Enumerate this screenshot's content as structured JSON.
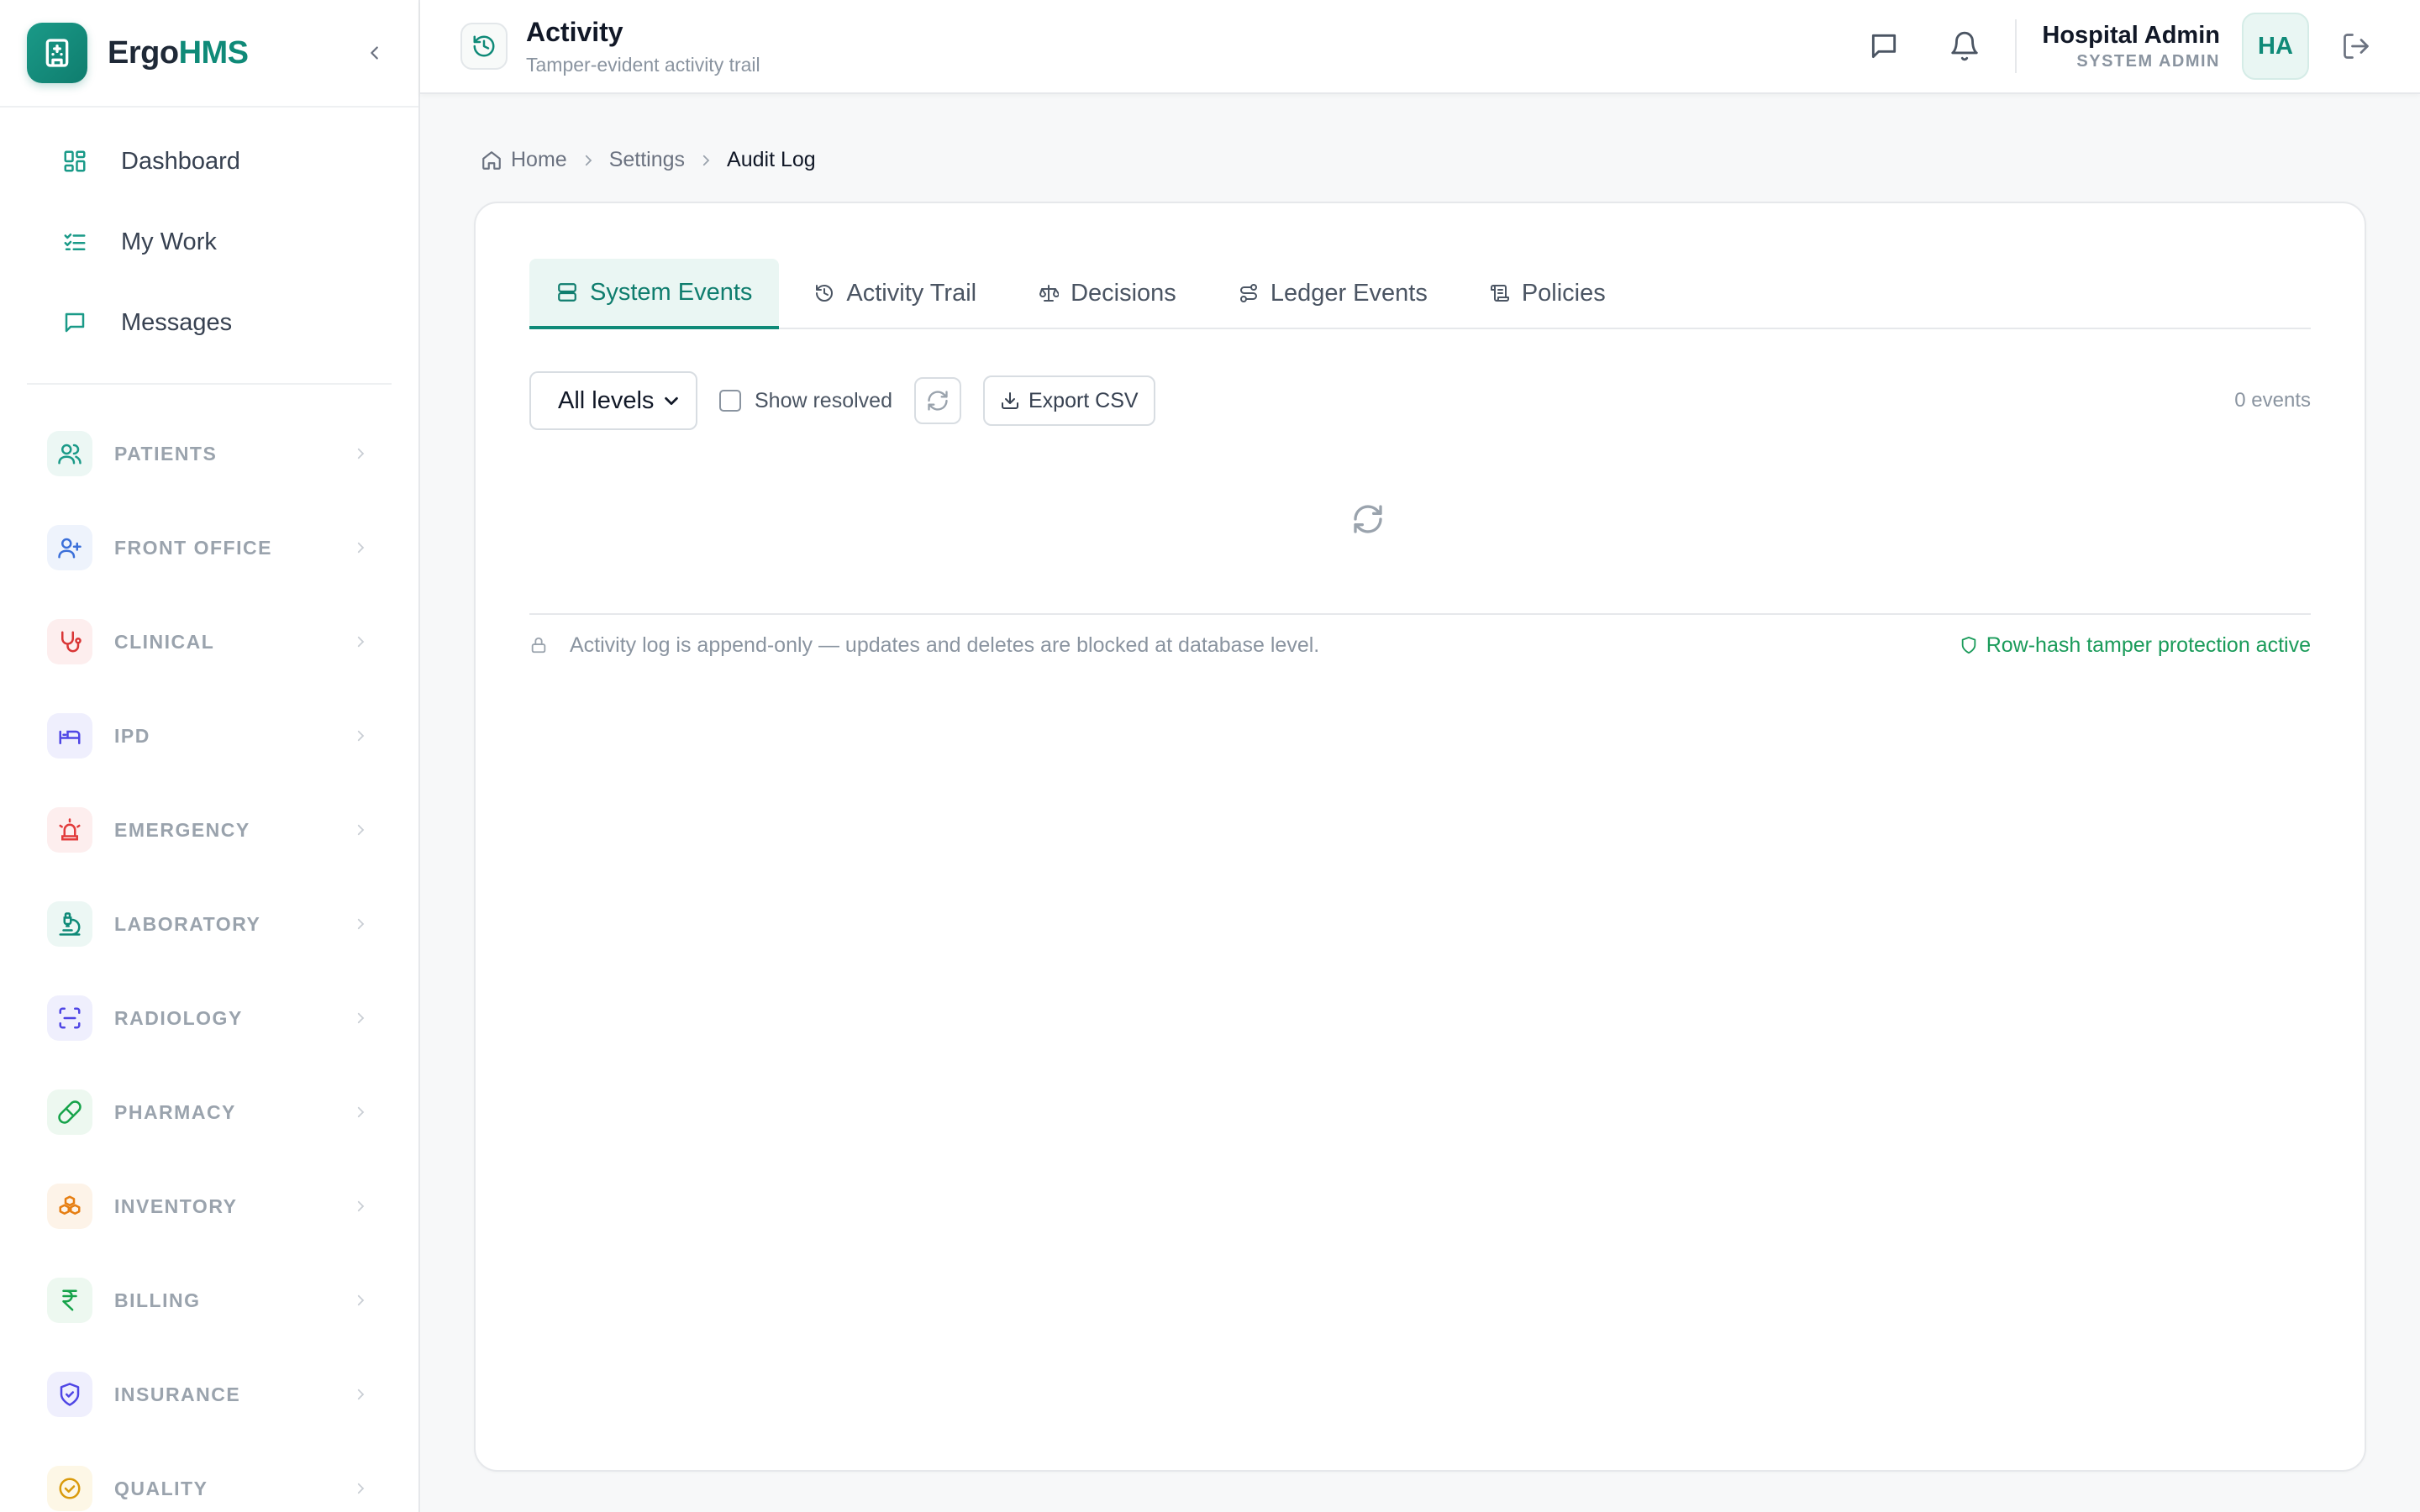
{
  "brand": {
    "name_part1": "Ergo",
    "name_part2": "HMS"
  },
  "sidebar": {
    "top_items": [
      {
        "label": "Dashboard",
        "icon": "dashboard-grid-icon"
      },
      {
        "label": "My Work",
        "icon": "checklist-icon"
      },
      {
        "label": "Messages",
        "icon": "message-icon"
      }
    ],
    "groups": [
      {
        "label": "PATIENTS",
        "icon": "users-icon",
        "color": "#1a9a88",
        "bg": "#ecf7f4"
      },
      {
        "label": "FRONT OFFICE",
        "icon": "user-plus-icon",
        "color": "#3b6fd9",
        "bg": "#eef3fc"
      },
      {
        "label": "CLINICAL",
        "icon": "stethoscope-icon",
        "color": "#d93636",
        "bg": "#fdeeee"
      },
      {
        "label": "IPD",
        "icon": "bed-icon",
        "color": "#4f46e5",
        "bg": "#efeffd"
      },
      {
        "label": "EMERGENCY",
        "icon": "siren-icon",
        "color": "#e23b3b",
        "bg": "#fdeeee"
      },
      {
        "label": "LABORATORY",
        "icon": "microscope-icon",
        "color": "#0f8a78",
        "bg": "#ecf7f4"
      },
      {
        "label": "RADIOLOGY",
        "icon": "scan-icon",
        "color": "#4f46e5",
        "bg": "#efeffd"
      },
      {
        "label": "PHARMACY",
        "icon": "pill-icon",
        "color": "#16a34a",
        "bg": "#edf8f0"
      },
      {
        "label": "INVENTORY",
        "icon": "boxes-icon",
        "color": "#e67e12",
        "bg": "#fdf3e8"
      },
      {
        "label": "BILLING",
        "icon": "rupee-icon",
        "color": "#16a34a",
        "bg": "#edf8f0"
      },
      {
        "label": "INSURANCE",
        "icon": "shield-check-icon",
        "color": "#4f46e5",
        "bg": "#efeffd"
      },
      {
        "label": "QUALITY",
        "icon": "check-circle-icon",
        "color": "#d99a0b",
        "bg": "#fdf7e6"
      }
    ]
  },
  "header": {
    "title": "Activity",
    "subtitle": "Tamper-evident activity trail",
    "user_name": "Hospital Admin",
    "user_role": "SYSTEM ADMIN",
    "avatar_initials": "HA"
  },
  "breadcrumb": {
    "home": "Home",
    "settings": "Settings",
    "current": "Audit Log"
  },
  "tabs": [
    {
      "label": "System Events",
      "icon": "server-icon",
      "active": true
    },
    {
      "label": "Activity Trail",
      "icon": "history-icon",
      "active": false
    },
    {
      "label": "Decisions",
      "icon": "scale-icon",
      "active": false
    },
    {
      "label": "Ledger Events",
      "icon": "route-icon",
      "active": false
    },
    {
      "label": "Policies",
      "icon": "scroll-icon",
      "active": false
    }
  ],
  "toolbar": {
    "level_select": "All levels",
    "show_resolved_label": "Show resolved",
    "show_resolved_checked": false,
    "export_label": "Export CSV",
    "event_count": "0 events"
  },
  "footer": {
    "append_only_note": "Activity log is append-only — updates and deletes are blocked at database level.",
    "tamper_note": "Row-hash tamper protection active"
  },
  "colors": {
    "accent": "#0f8a78",
    "success": "#1a9b5a"
  }
}
